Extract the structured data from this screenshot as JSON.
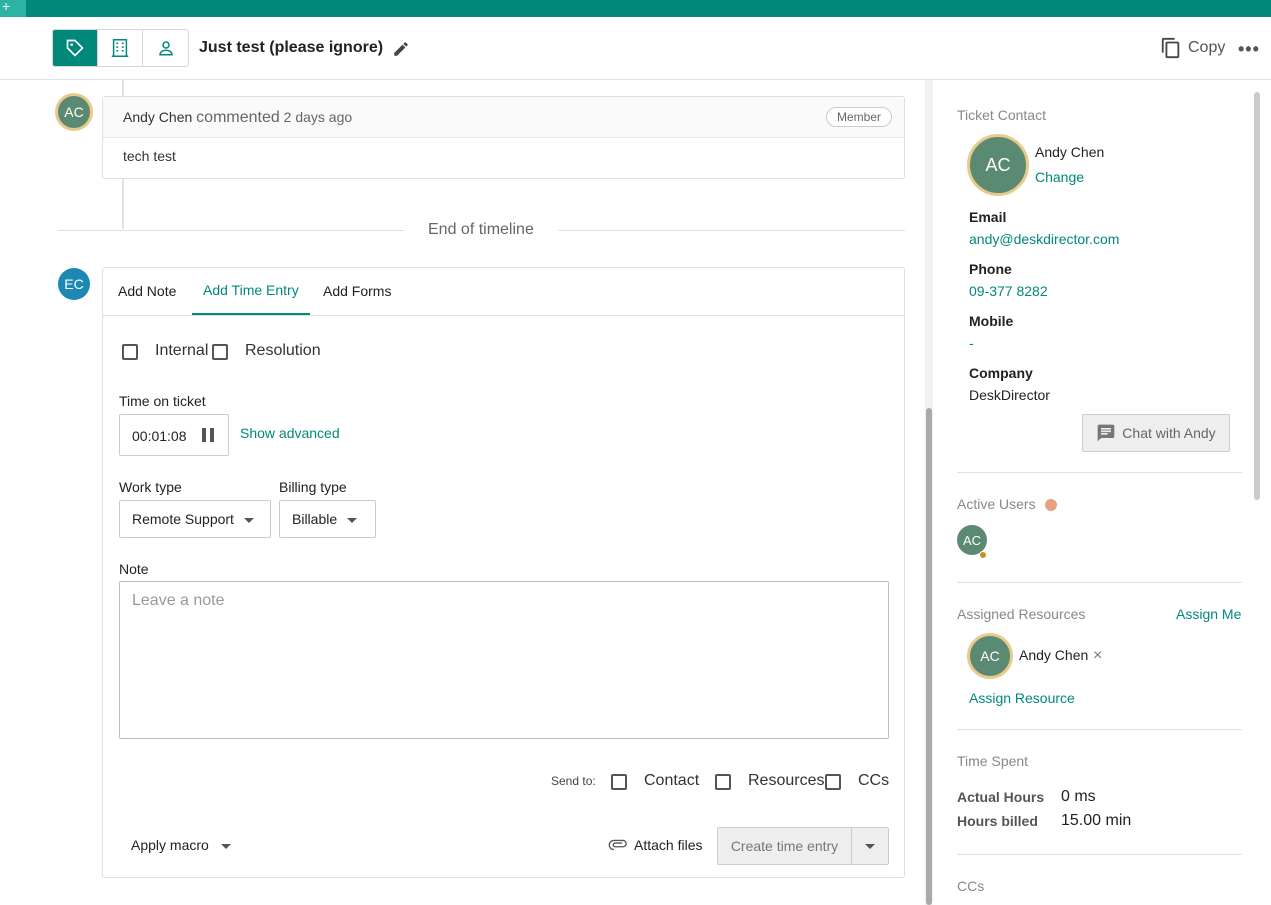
{
  "header": {
    "title": "Just test (please ignore)",
    "copy_label": "Copy",
    "more_label": "•••"
  },
  "timeline": {
    "comment": {
      "avatar": "AC",
      "author": "Andy Chen",
      "verb": "commented",
      "time": "2 days ago",
      "role": "Member",
      "body": "tech test"
    },
    "end_label": "End of timeline"
  },
  "composer": {
    "avatar": "EC",
    "tabs": [
      "Add Note",
      "Add Time Entry",
      "Add Forms"
    ],
    "active_tab": "Add Time Entry",
    "internal_label": "Internal",
    "resolution_label": "Resolution",
    "time_label": "Time on ticket",
    "timer_value": "00:01:08",
    "show_advanced": "Show advanced",
    "work_type_label": "Work type",
    "work_type_value": "Remote Support",
    "billing_type_label": "Billing type",
    "billing_type_value": "Billable",
    "note_label": "Note",
    "note_placeholder": "Leave a note",
    "send_to_label": "Send to:",
    "send_contact": "Contact",
    "send_resources": "Resources",
    "send_ccs": "CCs",
    "apply_macro": "Apply macro",
    "attach_files": "Attach files",
    "create_button": "Create time entry"
  },
  "sidebar": {
    "ticket_contact_heading": "Ticket Contact",
    "contact_avatar": "AC",
    "contact_name": "Andy Chen",
    "change_label": "Change",
    "email_label": "Email",
    "email_value": "andy@deskdirector.com",
    "phone_label": "Phone",
    "phone_value": "09-377 8282",
    "mobile_label": "Mobile",
    "mobile_value": "-",
    "company_label": "Company",
    "company_value": "DeskDirector",
    "chat_button": "Chat with Andy",
    "active_users_heading": "Active Users",
    "active_user_avatar": "AC",
    "assigned_heading": "Assigned Resources",
    "assign_me": "Assign Me",
    "assigned_avatar": "AC",
    "assigned_name": "Andy Chen",
    "remove_icon": "×",
    "assign_resource": "Assign Resource",
    "time_spent_heading": "Time Spent",
    "actual_hours_label": "Actual Hours",
    "actual_hours_value": "0 ms",
    "hours_billed_label": "Hours billed",
    "hours_billed_value": "15.00 min",
    "ccs_heading": "CCs"
  },
  "colors": {
    "brand": "#00897b",
    "avatar": "#5b8a72",
    "composer_avatar": "#1e88b5",
    "ring": "#e9c98c",
    "presence": "#e8a080"
  },
  "icons": [
    "tag-icon",
    "building-icon",
    "person-icon",
    "pencil-icon",
    "copy-icon",
    "more-icon",
    "pause-icon",
    "chat-icon",
    "paperclip-icon",
    "close-icon",
    "chevron-down-icon"
  ]
}
